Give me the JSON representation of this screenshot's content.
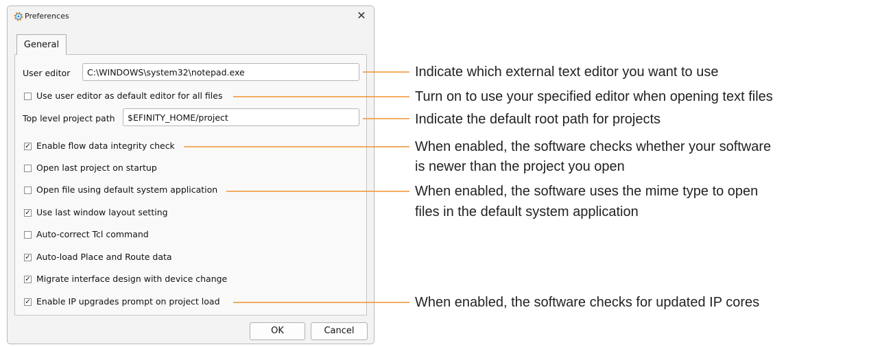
{
  "window": {
    "title": "Preferences",
    "icon": "gear-icon",
    "close_glyph": "✕"
  },
  "tabs": [
    {
      "label": "General"
    }
  ],
  "fields": {
    "user_editor": {
      "label": "User editor",
      "value": "C:\\WINDOWS\\system32\\notepad.exe"
    },
    "top_level_path": {
      "label": "Top level project path",
      "value": "$EFINITY_HOME/project"
    }
  },
  "checkboxes": [
    {
      "label": "Use user editor as default editor for all files",
      "checked": false
    },
    {
      "label": "Enable flow data integrity check",
      "checked": true
    },
    {
      "label": "Open last project on startup",
      "checked": false
    },
    {
      "label": "Open file using default system application",
      "checked": false
    },
    {
      "label": "Use last window layout setting",
      "checked": true
    },
    {
      "label": "Auto-correct Tcl command",
      "checked": false
    },
    {
      "label": "Auto-load Place and Route data",
      "checked": true
    },
    {
      "label": "Migrate interface design with device change",
      "checked": true
    },
    {
      "label": "Enable IP upgrades prompt on project load",
      "checked": true
    }
  ],
  "buttons": {
    "ok": "OK",
    "cancel": "Cancel"
  },
  "annotations": [
    {
      "text": "Indicate which external text editor you want to use"
    },
    {
      "text": "Turn on to use your specified editor when opening text files"
    },
    {
      "text": "Indicate the default root path for projects"
    },
    {
      "text": "When enabled, the software checks whether your software"
    },
    {
      "text": "is newer than the project you open"
    },
    {
      "text": "When enabled, the software uses the mime type to open"
    },
    {
      "text": "files in the default system application"
    },
    {
      "text": "When enabled, the software checks for updated IP cores"
    }
  ],
  "colors": {
    "annotation_line": "#f0922e",
    "dialog_bg": "#f3f3f3",
    "panel_bg": "#f9f9f9"
  }
}
